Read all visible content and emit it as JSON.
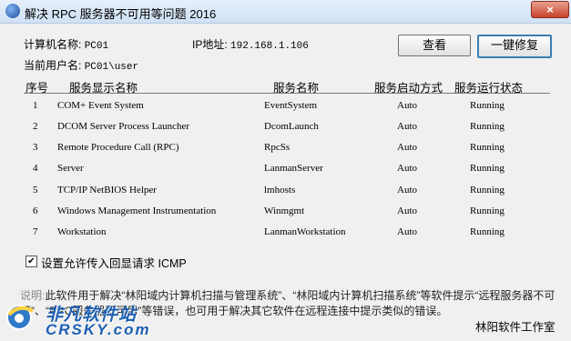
{
  "window": {
    "title": "解决 RPC 服务器不可用等问题 2016",
    "close_label": "×"
  },
  "info": {
    "computer_label": "计算机名称:",
    "computer_value": "PC01",
    "ip_label": "IP地址:",
    "ip_value": "192.168.1.106",
    "user_label": "当前用户名:",
    "user_value": "PC01\\user"
  },
  "buttons": {
    "query": "查看",
    "fix": "一键修复"
  },
  "table": {
    "columns": [
      "序号",
      "服务显示名称",
      "服务名称",
      "服务启动方式",
      "服务运行状态"
    ],
    "rows": [
      {
        "no": "1",
        "display": "COM+ Event System",
        "name": "EventSystem",
        "start": "Auto",
        "status": "Running"
      },
      {
        "no": "2",
        "display": "DCOM Server Process Launcher",
        "name": "DcomLaunch",
        "start": "Auto",
        "status": "Running"
      },
      {
        "no": "3",
        "display": "Remote Procedure Call (RPC)",
        "name": "RpcSs",
        "start": "Auto",
        "status": "Running"
      },
      {
        "no": "4",
        "display": "Server",
        "name": "LanmanServer",
        "start": "Auto",
        "status": "Running"
      },
      {
        "no": "5",
        "display": "TCP/IP NetBIOS Helper",
        "name": "lmhosts",
        "start": "Auto",
        "status": "Running"
      },
      {
        "no": "6",
        "display": "Windows Management Instrumentation",
        "name": "Winmgmt",
        "start": "Auto",
        "status": "Running"
      },
      {
        "no": "7",
        "display": "Workstation",
        "name": "LanmanWorkstation",
        "start": "Auto",
        "status": "Running"
      }
    ]
  },
  "checkbox": {
    "label": "设置允许传入回显请求 ICMP",
    "checked": true,
    "mark": "✔"
  },
  "note": {
    "label": "说明:",
    "text": "此软件用于解决“林阳域内计算机扫描与管理系统”、“林阳域内计算机扫描系统”等软件提示“远程服务器不可用”、“RPC服务器不可用”等错误，也可用于解决其它软件在远程连接中提示类似的错误。"
  },
  "company": "林阳软件工作室",
  "watermark": {
    "cn": "非凡软件站",
    "en": "CRSKY.com"
  },
  "colors": {
    "accent": "#3c7fb1",
    "close": "#c7432b",
    "watermark": "#1d5fb0"
  }
}
